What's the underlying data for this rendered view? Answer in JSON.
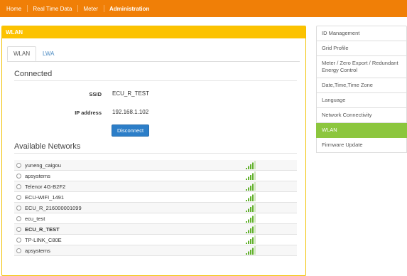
{
  "nav": {
    "items": [
      {
        "label": "Home"
      },
      {
        "label": "Real Time Data"
      },
      {
        "label": "Meter"
      },
      {
        "label": "Administration"
      }
    ]
  },
  "panel": {
    "title": "WLAN",
    "tabs": [
      {
        "label": "WLAN"
      },
      {
        "label": "LWA"
      }
    ],
    "connected": {
      "heading": "Connected",
      "ssid_label": "SSID",
      "ssid_value": "ECU_R_TEST",
      "ip_label": "IP address",
      "ip_value": "192.168.1.102",
      "disconnect_label": "Disconnect"
    },
    "available": {
      "heading": "Available Networks",
      "networks": [
        {
          "name": "yuneng_caigou",
          "signal": 4
        },
        {
          "name": "apsystems",
          "signal": 4
        },
        {
          "name": "Telenor 4G-B2F2",
          "signal": 4
        },
        {
          "name": "ECU-WIFI_1491",
          "signal": 4
        },
        {
          "name": "ECU_R_216000001099",
          "signal": 4
        },
        {
          "name": "ecu_test",
          "signal": 4
        },
        {
          "name": "ECU_R_TEST",
          "signal": 4
        },
        {
          "name": "TP-LINK_C80E",
          "signal": 4
        },
        {
          "name": "apsystems",
          "signal": 4
        }
      ]
    }
  },
  "sidebar": {
    "items": [
      {
        "label": "ID Management"
      },
      {
        "label": "Grid Profile"
      },
      {
        "label": "Meter / Zero Export / Redundant Energy Control"
      },
      {
        "label": "Date,Time,Time Zone"
      },
      {
        "label": "Language"
      },
      {
        "label": "Network Connectivity"
      },
      {
        "label": "WLAN"
      },
      {
        "label": "Firmware Update"
      }
    ]
  },
  "colors": {
    "topbar": "#f07f07",
    "panel_header": "#fcc200",
    "active_menu": "#8cc63e",
    "button": "#2c7ec8",
    "signal": "#62b12c"
  }
}
